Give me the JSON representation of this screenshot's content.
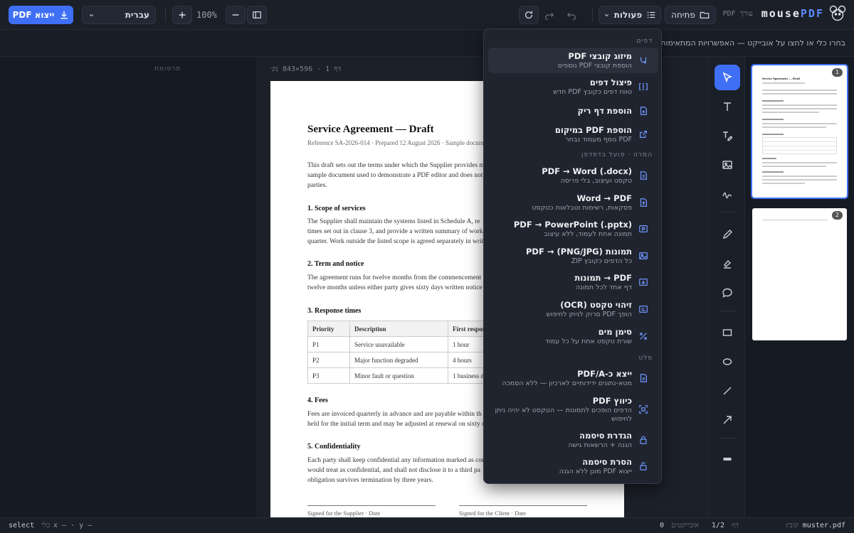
{
  "header": {
    "logo_text_main": "mouse",
    "logo_text_accent": "PDF",
    "logo_sub": "עורך PDF",
    "open_label": "פתיחה",
    "actions_label": "פעולות",
    "zoom": "100%",
    "language": "עברית",
    "export_label": "ייצוא PDF"
  },
  "hint": "בחרו כלי או לחצו על אובייקט — האפשרויות המתאימות יו",
  "ads_label": "פרסומת",
  "page_info": "דף 1 · 596×843 נק׳",
  "document": {
    "title": "Service Agreement — Draft",
    "subtitle": "Reference SA-2026-014 · Prepared 12 August 2026 · Sample document",
    "intro": [
      "This draft sets out the terms under which the Supplier provides m",
      "sample document used to demonstrate a PDF editor and does not c",
      "parties."
    ],
    "s1_title": "1. Scope of services",
    "s1": [
      "The Supplier shall maintain the systems listed in Schedule A, re",
      "times set out in clause 3, and provide a written summary of work",
      "quarter. Work outside the listed scope is agreed separately in writin"
    ],
    "s2_title": "2. Term and notice",
    "s2": [
      "The agreement runs for twelve months from the commencement",
      "twelve months unless either party gives sixty days written notice be"
    ],
    "s3_title": "3. Response times",
    "table": {
      "headers": [
        "Priority",
        "Description",
        "First respon"
      ],
      "rows": [
        [
          "P1",
          "Service unavailable",
          "1 hour"
        ],
        [
          "P2",
          "Major function degraded",
          "4 hours"
        ],
        [
          "P3",
          "Minor fault or question",
          "1 business da"
        ]
      ]
    },
    "s4_title": "4. Fees",
    "s4": [
      "Fees are invoiced quarterly in advance and are payable within th",
      "held for the initial term and may be adjusted at renewal on sixty da"
    ],
    "s5_title": "5. Confidentiality",
    "s5": [
      "Each party shall keep confidential any information marked as con",
      "would treat as confidential, and shall not disclose it to a third pa",
      "obligation survives termination by three years."
    ],
    "sig_supplier": "Signed for the Supplier · Date",
    "sig_client": "Signed for the Client · Date"
  },
  "menu": {
    "sections": [
      "דפים",
      "המרה · פועל בדפדפן",
      "פלט"
    ],
    "items": [
      {
        "title": "מיזוג קובצי PDF",
        "desc": "הוספת קובצי PDF נוספים"
      },
      {
        "title": "פיצול דפים",
        "desc": "טווח דפים כקובץ PDF חדש"
      },
      {
        "title": "הוספת דף ריק",
        "desc": ""
      },
      {
        "title": "הוספת PDF במיקום",
        "desc": "PDF נוסף מעמוד נבחר"
      },
      {
        "title": "PDF → Word (.docx)",
        "desc": "טקסט ועיצוב, בלי פריסה"
      },
      {
        "title": "Word → PDF",
        "desc": "פסקאות, רשימות וטבלאות כטקסט"
      },
      {
        "title": "PDF → PowerPoint (.pptx)",
        "desc": "תמונה אחת לעמוד, ללא עיצוב"
      },
      {
        "title": "תמונות (PNG/JPG) → PDF",
        "desc": "כל הדפים כקובץ ZIP"
      },
      {
        "title": "PDF → תמונות",
        "desc": "דף אחד לכל תמונה"
      },
      {
        "title": "זיהוי טקסט (OCR)",
        "desc": "הופך PDF סרוק לניתן לחיפוש"
      },
      {
        "title": "סימן מים",
        "desc": "שורת טקסט אחת על כל עמוד"
      },
      {
        "title": "ייצא כ-PDF/A",
        "desc": "מטא-נתונים ידידותיים לארכיון — ללא הסמכה"
      },
      {
        "title": "כיווץ PDF",
        "desc": "הדפים הופכים לתמונות — הטקסט לא יהיה ניתן לחיפוש"
      },
      {
        "title": "הגדרת סיסמה",
        "desc": "הגנה + הרשאות גישה"
      },
      {
        "title": "הסרת סיסמה",
        "desc": "ייצוא PDF מוגן ללא הגנה"
      }
    ]
  },
  "thumbnails": [
    {
      "num": "1"
    },
    {
      "num": "2"
    }
  ],
  "thumb_title": "Service Agreement — Draft",
  "status": {
    "file_label": "קובץ",
    "file_name": "muster.pdf",
    "page_label": "דף",
    "page_value": "1/2",
    "objects_label": "אובייקטים",
    "objects_value": "0",
    "coords": "x — · y —",
    "tool_label": "כלי",
    "tool_value": "select"
  },
  "colors": {
    "accent": "#3f6ff5",
    "menu_icon": "#6f96ff"
  }
}
